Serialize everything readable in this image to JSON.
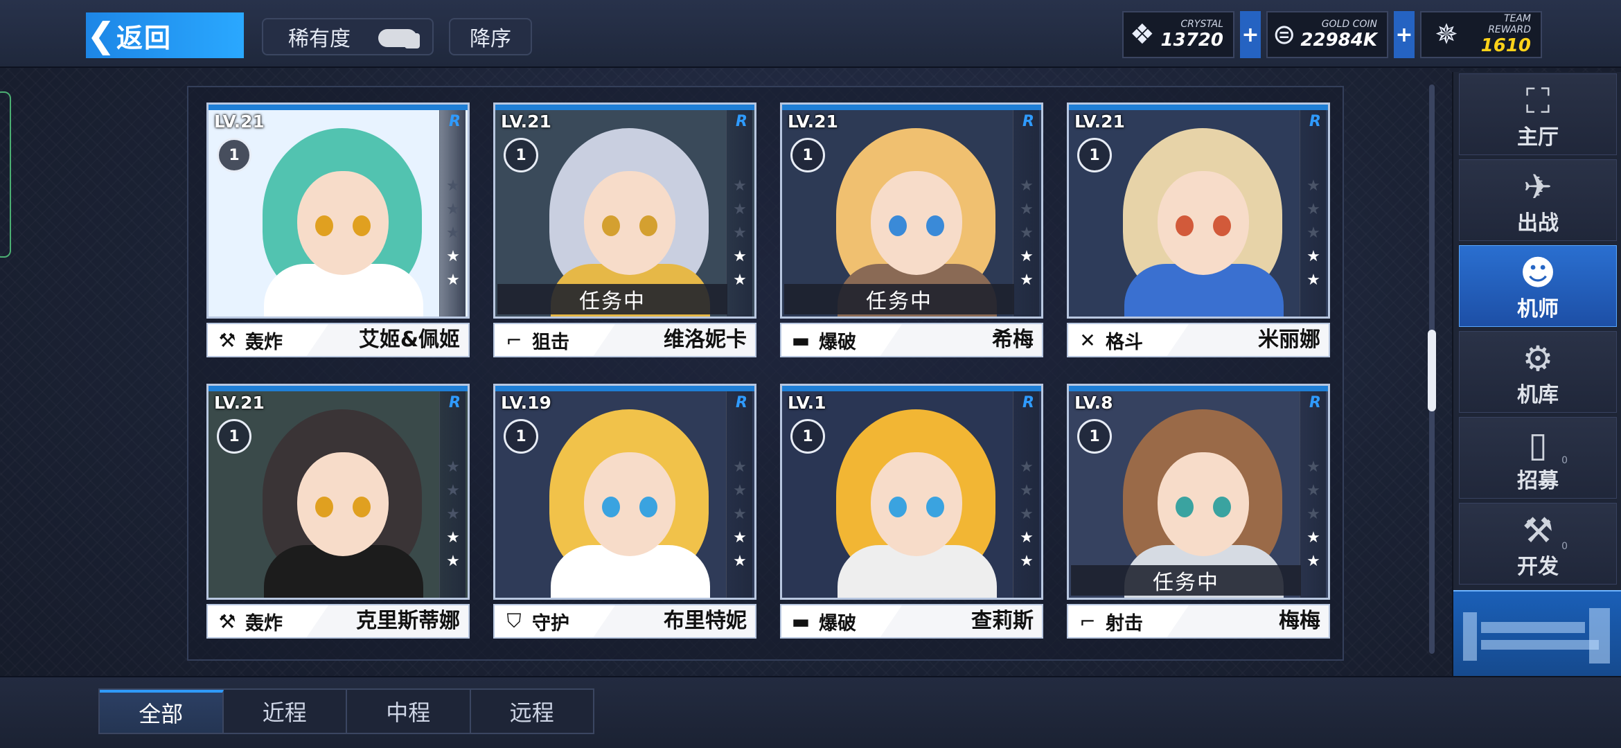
{
  "header": {
    "back_label": "返回",
    "rarity_label": "稀有度",
    "order_label": "降序"
  },
  "resources": {
    "crystal": {
      "name": "CRYSTAL",
      "value": "13720",
      "icon": "crystal-icon"
    },
    "gold": {
      "name": "GOLD COIN",
      "value": "22984K",
      "icon": "gold-coin-icon"
    },
    "team": {
      "name": "TEAM REWARD",
      "value": "1610",
      "icon": "team-reward-icon"
    },
    "plus_symbol": "+"
  },
  "pilots": [
    {
      "level": "LV.21",
      "rank": "1",
      "rarity": "R",
      "role": "轰炸",
      "name": "艾姬&佩姬",
      "mission": "",
      "stars": 2
    },
    {
      "level": "LV.21",
      "rank": "1",
      "rarity": "R",
      "role": "狙击",
      "name": "维洛妮卡",
      "mission": "任务中",
      "stars": 2
    },
    {
      "level": "LV.21",
      "rank": "1",
      "rarity": "R",
      "role": "爆破",
      "name": "希梅",
      "mission": "任务中",
      "stars": 2
    },
    {
      "level": "LV.21",
      "rank": "1",
      "rarity": "R",
      "role": "格斗",
      "name": "米丽娜",
      "mission": "",
      "stars": 2
    },
    {
      "level": "LV.21",
      "rank": "1",
      "rarity": "R",
      "role": "轰炸",
      "name": "克里斯蒂娜",
      "mission": "",
      "stars": 2
    },
    {
      "level": "LV.19",
      "rank": "1",
      "rarity": "R",
      "role": "守护",
      "name": "布里特妮",
      "mission": "",
      "stars": 2
    },
    {
      "level": "LV.1",
      "rank": "1",
      "rarity": "R",
      "role": "爆破",
      "name": "查莉斯",
      "mission": "",
      "stars": 2
    },
    {
      "level": "LV.8",
      "rank": "1",
      "rarity": "R",
      "role": "射击",
      "name": "梅梅",
      "mission": "任务中",
      "stars": 2
    }
  ],
  "nav": [
    {
      "label": "主厅",
      "icon": "lobby-icon",
      "active": false
    },
    {
      "label": "出战",
      "icon": "sortie-icon",
      "active": false
    },
    {
      "label": "机师",
      "icon": "pilot-icon",
      "active": true
    },
    {
      "label": "机库",
      "icon": "hangar-icon",
      "active": false
    },
    {
      "label": "招募",
      "icon": "recruit-icon",
      "active": false,
      "badge": "0"
    },
    {
      "label": "开发",
      "icon": "develop-icon",
      "active": false,
      "badge": "0"
    }
  ],
  "tabs": [
    {
      "label": "全部",
      "active": true
    },
    {
      "label": "近程",
      "active": false
    },
    {
      "label": "中程",
      "active": false
    },
    {
      "label": "远程",
      "active": false
    }
  ],
  "colors": {
    "accent": "#2f9bff",
    "team_reward": "#ffd21a",
    "active_nav": "#2a6fd0"
  }
}
